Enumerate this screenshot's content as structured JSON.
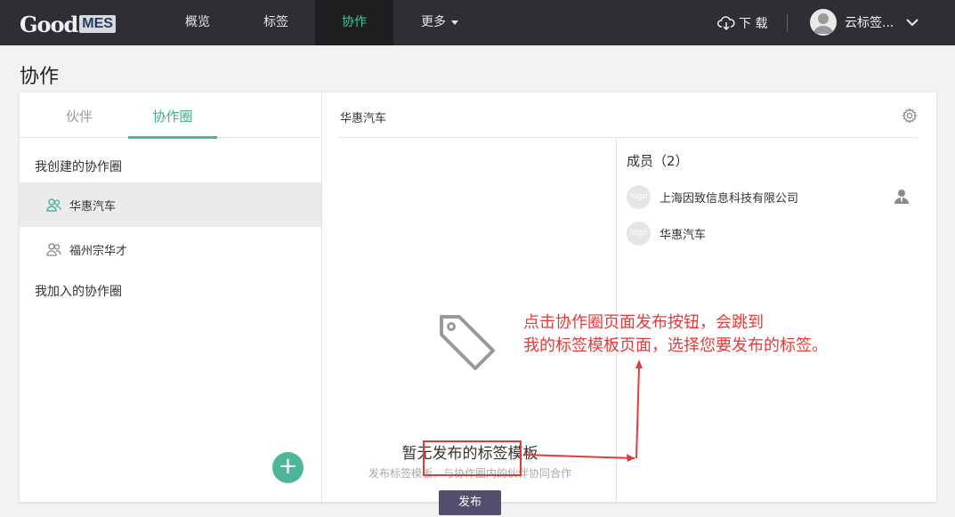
{
  "app": {
    "logo_text": "Good",
    "logo_badge": "MES"
  },
  "nav": {
    "items": [
      {
        "label": "概览"
      },
      {
        "label": "标签"
      },
      {
        "label": "协作"
      },
      {
        "label": "更多"
      }
    ],
    "download_label": "下 载",
    "username": "云标签..."
  },
  "page": {
    "title": "协作"
  },
  "left_panel": {
    "tabs": [
      {
        "label": "伙伴"
      },
      {
        "label": "协作圈"
      }
    ],
    "created_section_label": "我创建的协作圈",
    "created_circles": [
      {
        "label": "华惠汽车"
      },
      {
        "label": "福州宗华才"
      }
    ],
    "joined_section_label": "我加入的协作圈",
    "add_button_label": "+"
  },
  "circle_detail": {
    "title": "华惠汽车",
    "empty_state": {
      "title": "暂无发布的标签模板",
      "subtitle": "发布标签模板，与协作圈内的伙伴协同合作",
      "publish_label": "发布"
    },
    "members": {
      "title": "成员（2）",
      "list": [
        {
          "name": "上海因致信息科技有限公司",
          "logo": "logo"
        },
        {
          "name": "华惠汽车",
          "logo": "logo"
        }
      ]
    }
  },
  "annotation": {
    "line1": "点击协作圈页面发布按钮，会跳到",
    "line2": "我的标签模板页面，选择您要发布的标签。"
  },
  "colors": {
    "accent": "#4cb59a",
    "nav_bg": "#2f2f33",
    "publish_bg": "#524e6e",
    "annotation_red": "#e23b3b"
  }
}
